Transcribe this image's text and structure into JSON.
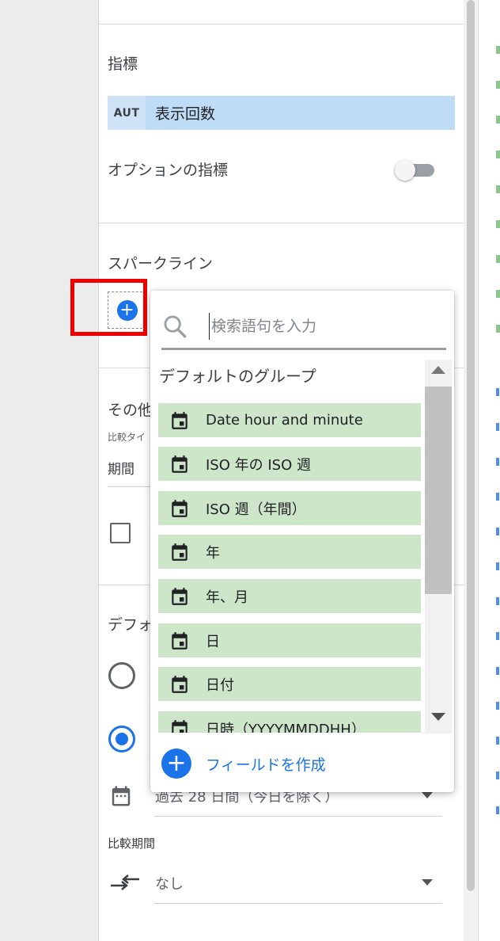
{
  "panel": {
    "metric_section_title": "指標",
    "metric_chip": {
      "type_badge": "AUT",
      "name": "表示回数"
    },
    "optional_metrics_label": "オプションの指標",
    "optional_metrics_enabled": false,
    "sparkline_title": "スパークライン",
    "other_section_title_partial": "その他",
    "comparison_type_label_partial": "比較タイ",
    "period_label_partial": "期間",
    "default_range_title_partial": "デフォ",
    "date_range_value": "過去 28 日間（今日を除く）",
    "comparison_period_label": "比較期間",
    "comparison_period_value": "なし"
  },
  "popup": {
    "search_placeholder": "検索語句を入力",
    "group_title": "デフォルトのグループ",
    "fields": [
      "Date hour and minute",
      "ISO 年の ISO 週",
      "ISO 週（年間）",
      "年",
      "年、月",
      "日",
      "日付",
      "日時（YYYYMMDDHH）"
    ],
    "create_field_label": "フィールドを作成"
  },
  "icons": {
    "search": "search-icon",
    "calendar": "calendar-icon",
    "add": "add-circle-icon",
    "compare": "compare-arrows-icon"
  },
  "colors": {
    "accent": "#1a73e8",
    "metric_chip": "#bfdcf7",
    "field_chip": "#cde6ca",
    "highlight": "#ee0000"
  }
}
